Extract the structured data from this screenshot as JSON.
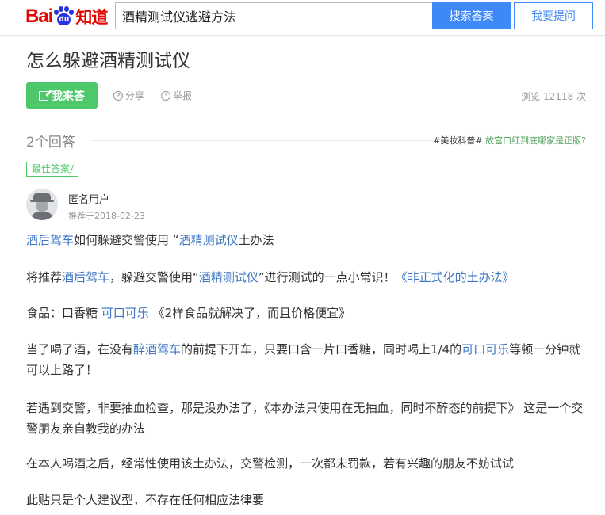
{
  "header": {
    "logo_bai": "Bai",
    "logo_du": "du",
    "logo_zhidao": "知道",
    "search_value": "酒精测试仪逃避方法",
    "search_button": "搜索答案",
    "ask_button": "我要提问"
  },
  "question": {
    "title": "怎么躲避酒精测试仪",
    "answer_button": "我来答",
    "share": "分享",
    "report": "举报",
    "views": "浏览 12118 次"
  },
  "answers_bar": {
    "count": "2个回答",
    "tag": "#美妆科普#",
    "link": "故宫口红到底哪家是正版?"
  },
  "best_answer": {
    "badge": "最佳答案",
    "user": "匿名用户",
    "date": "推荐于2018-02-23"
  },
  "content": {
    "p1": {
      "a": "酒后驾车",
      "b": "如何躲避交警使用 “",
      "c": "酒精测试仪",
      "d": "土办法"
    },
    "p2": {
      "a": "将推荐",
      "b": "酒后驾车",
      "c": "，躲避交警使用“",
      "d": "酒精测试仪",
      "e": "”进行测试的一点小常识！",
      "f": "《非正式化的土办法》"
    },
    "p3": {
      "a": "食品：口香糖 ",
      "b": "可口可乐",
      "c": " 《2样食品就解决了，而且价格便宜》"
    },
    "p4": {
      "a": "当了喝了酒，在没有",
      "b": "醉酒驾车",
      "c": "的前提下开车，只要口含一片口香糖，同时喝上1/4的",
      "d": "可口可乐",
      "e": "等顿一分钟就可以上路了！"
    },
    "p5": "若遇到交警，非要抽血检查，那是没办法了，《本办法只使用在无抽血，同时不醉态的前提下》 这是一个交警朋友亲自教我的办法",
    "p6": "在本人喝酒之后，经常性使用该土办法，交警检测，一次都未罚款，若有兴趣的朋友不妨试试",
    "p7": "此贴只是个人建议型，不存在任何相应法律要"
  }
}
